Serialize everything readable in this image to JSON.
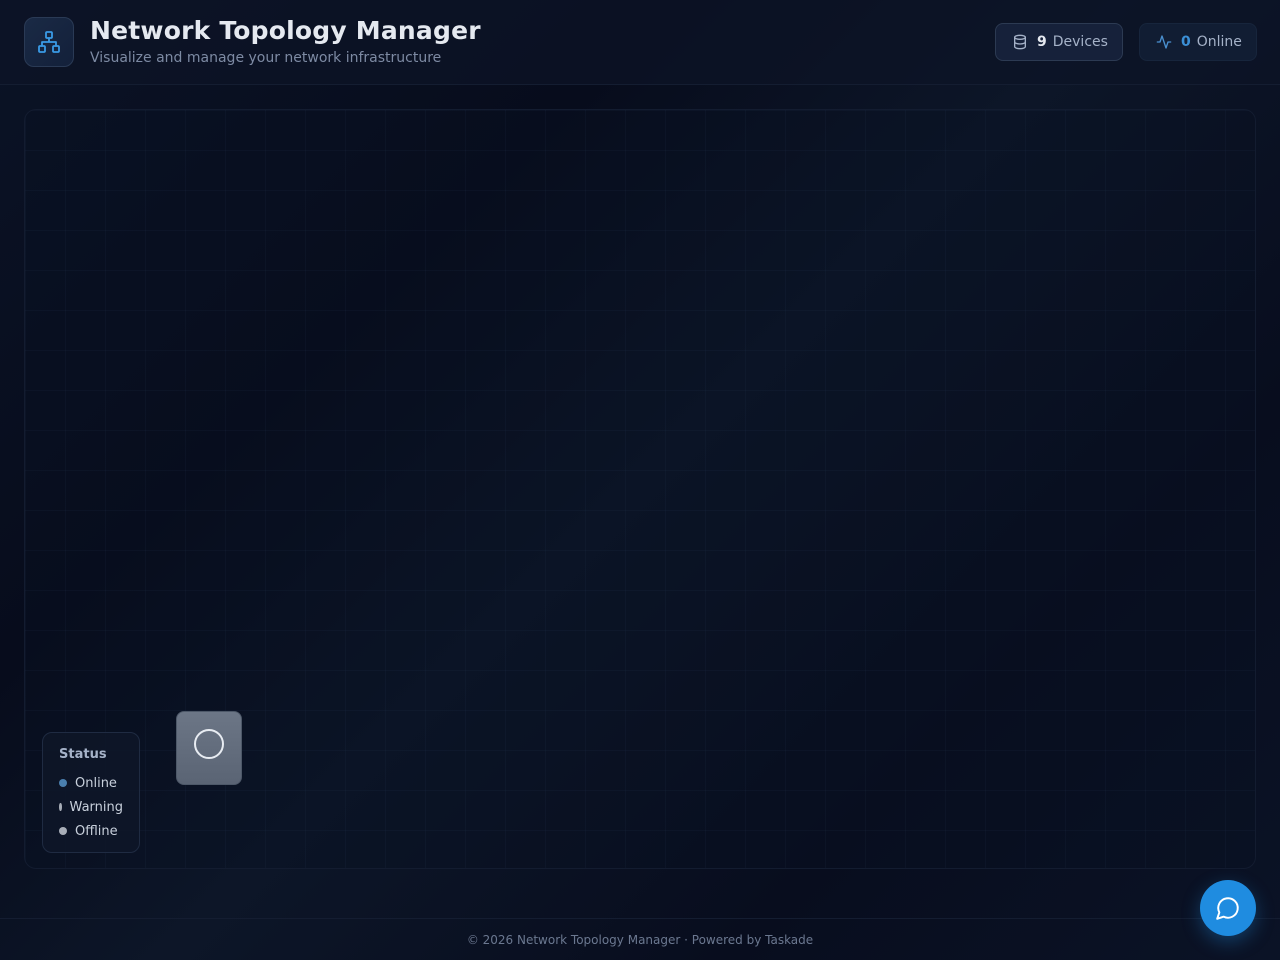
{
  "header": {
    "title": "Network Topology Manager",
    "subtitle": "Visualize and manage your network infrastructure",
    "logo_icon": "network-icon",
    "stats": {
      "devices_count": "9",
      "devices_label": "Devices",
      "devices_icon": "database-icon",
      "online_count": "0",
      "online_label": "Online",
      "online_icon": "activity-icon"
    }
  },
  "legend": {
    "title": "Status",
    "items": [
      {
        "label": "Online",
        "color": "#4a7fae"
      },
      {
        "label": "Warning",
        "color": "#a8aeb8"
      },
      {
        "label": "Offline",
        "color": "#a8aeb8"
      }
    ]
  },
  "device_node": {
    "icon": "loading-ring-icon"
  },
  "footer": {
    "text": "© 2026 Network Topology Manager · Powered by Taskade"
  },
  "chat_button": {
    "icon": "chat-bubble-icon"
  },
  "colors": {
    "accent": "#1f8ce0",
    "online_count": "#3b8fd6"
  }
}
